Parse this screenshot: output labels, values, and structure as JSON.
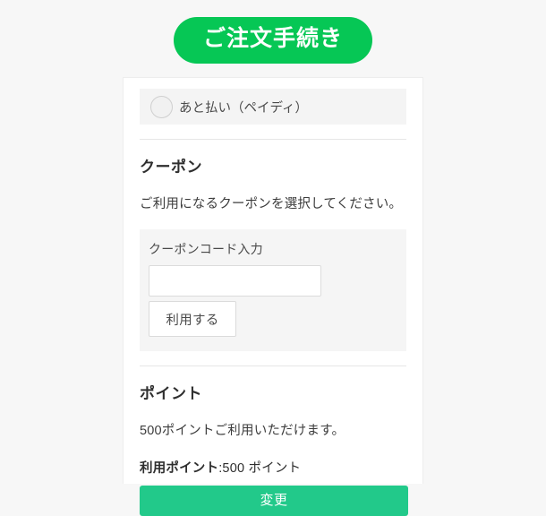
{
  "header": {
    "title": "ご注文手続き"
  },
  "card": {
    "payment": {
      "selected": false,
      "label": "あと払い（ペイディ）",
      "radio_icon": "radio-unchecked-icon"
    },
    "coupon": {
      "heading": "クーポン",
      "description": "ご利用になるクーポンを選択してください。",
      "field_label": "クーポンコード入力",
      "input_value": "",
      "input_placeholder": "",
      "apply_label": "利用する"
    },
    "points": {
      "heading": "ポイント",
      "available_text": "500ポイントご利用いただけます。",
      "used_label": "利用ポイント",
      "used_value": ":500 ポイント",
      "change_label": "変更"
    }
  },
  "colors": {
    "header_green": "#06c755",
    "button_green": "#22c98a",
    "page_background": "#f7f7f7",
    "card_background": "#ffffff",
    "panel_gray": "#f5f5f5",
    "row_gray": "#f4f4f4"
  }
}
